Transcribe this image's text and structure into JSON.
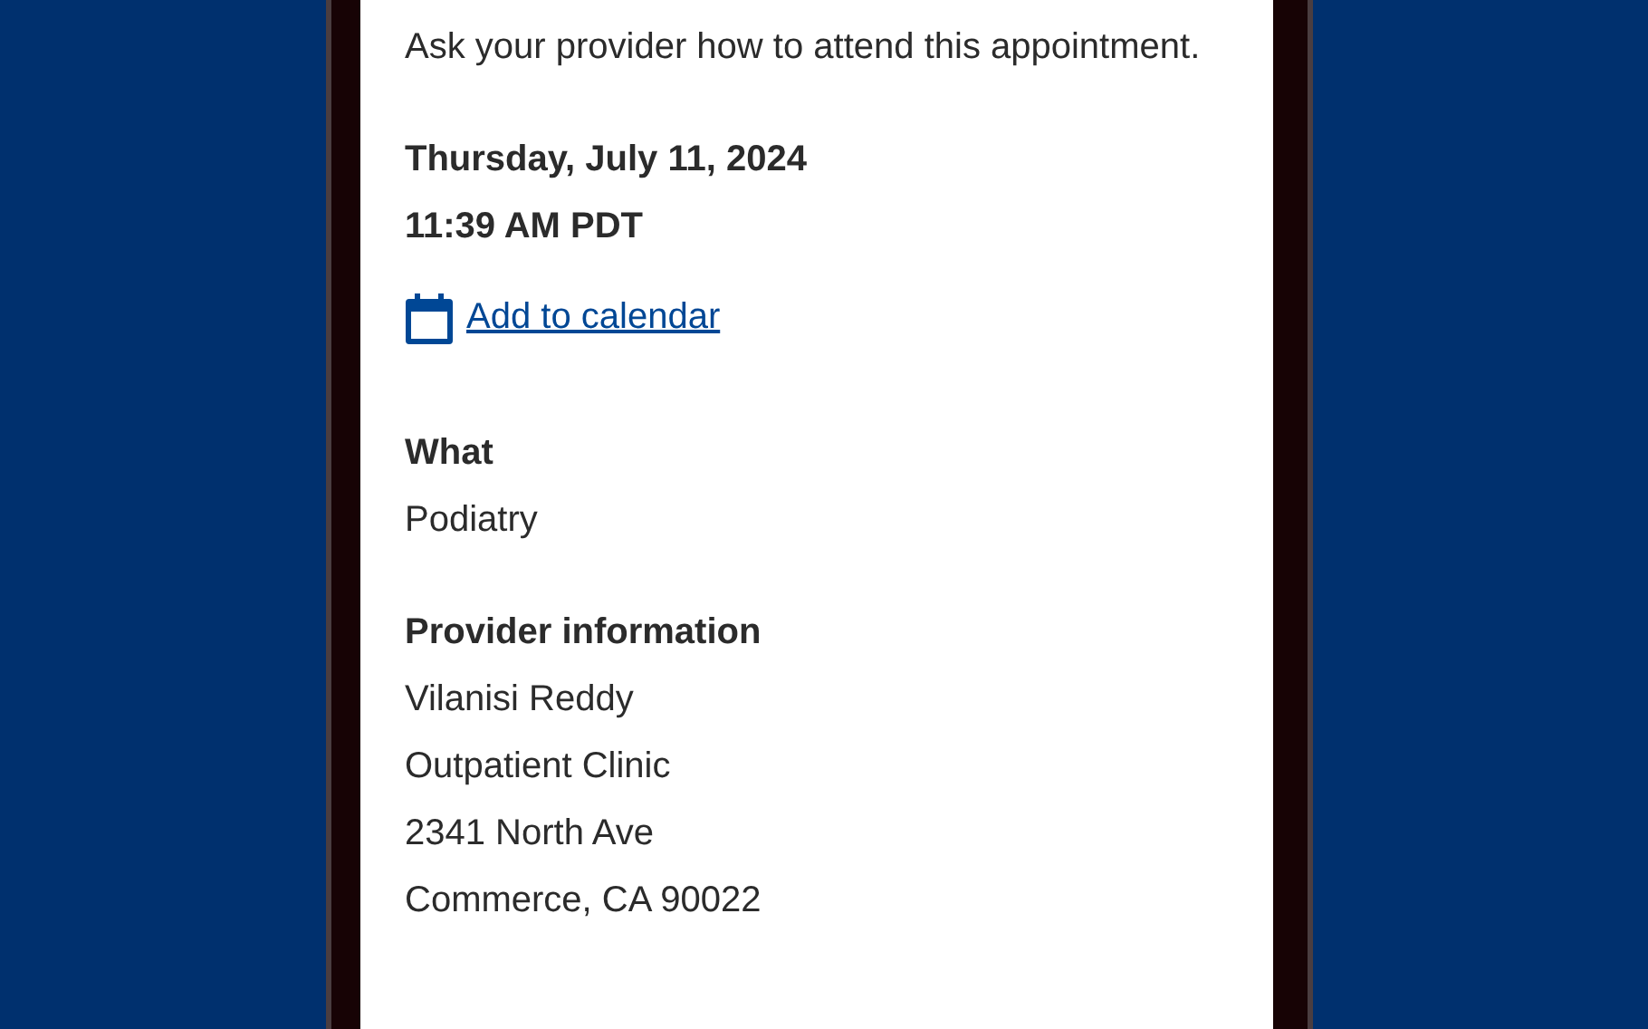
{
  "instructions": "Ask your provider how to attend this appointment.",
  "date": "Thursday, July 11, 2024",
  "time": "11:39 AM PDT",
  "calendar_link": "Add to calendar",
  "sections": [
    {
      "heading": "What",
      "lines": [
        "Podiatry"
      ]
    },
    {
      "heading": "Provider information",
      "lines": [
        "Vilanisi Reddy",
        "Outpatient Clinic",
        "2341 North Ave",
        "Commerce, CA 90022"
      ]
    }
  ]
}
